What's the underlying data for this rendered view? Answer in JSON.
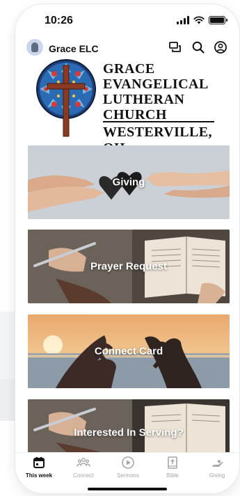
{
  "status_bar": {
    "time": "10:26"
  },
  "header": {
    "org_name": "Grace ELC",
    "icons": [
      "chat-icon",
      "search-icon",
      "account-icon"
    ]
  },
  "logo": {
    "line1": "GRACE",
    "line2": "EVANGELICAL",
    "line3": "LUTHERAN",
    "line4": "CHURCH",
    "city": "WESTERVILLE, OH"
  },
  "cards": [
    {
      "label": "Giving"
    },
    {
      "label": "Prayer Request"
    },
    {
      "label": "Connect Card"
    },
    {
      "label": "Interested In Serving?"
    }
  ],
  "tabs": [
    {
      "label": "This week",
      "icon": "calendar-icon",
      "active": true
    },
    {
      "label": "Connect",
      "icon": "people-icon",
      "active": false
    },
    {
      "label": "Sermons",
      "icon": "play-icon",
      "active": false
    },
    {
      "label": "Bible",
      "icon": "bible-icon",
      "active": false
    },
    {
      "label": "Giving",
      "icon": "giving-icon",
      "active": false
    }
  ],
  "colors": {
    "text": "#111111",
    "inactive": "#a6a6a6",
    "card_overlay_text": "#ffffff"
  }
}
